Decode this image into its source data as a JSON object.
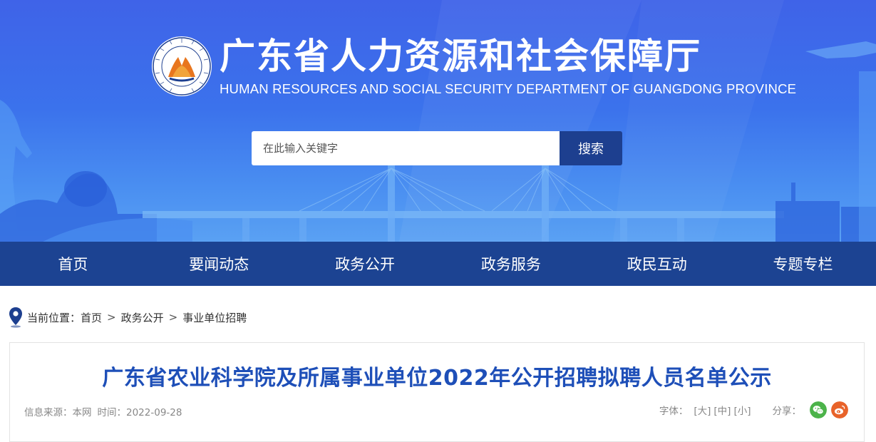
{
  "header": {
    "title_cn": "广东省人力资源和社会保障厅",
    "title_en": "HUMAN RESOURCES AND SOCIAL SECURITY DEPARTMENT OF GUANGDONG PROVINCE"
  },
  "search": {
    "placeholder": "在此输入关键字",
    "button_label": "搜索"
  },
  "nav": {
    "items": [
      {
        "label": "首页"
      },
      {
        "label": "要闻动态"
      },
      {
        "label": "政务公开"
      },
      {
        "label": "政务服务"
      },
      {
        "label": "政民互动"
      },
      {
        "label": "专题专栏"
      }
    ]
  },
  "breadcrumb": {
    "prefix": "当前位置：",
    "items": [
      {
        "label": "首页"
      },
      {
        "label": "政务公开"
      },
      {
        "label": "事业单位招聘"
      }
    ],
    "separator": ">"
  },
  "article": {
    "title": "广东省农业科学院及所属事业单位2022年公开招聘拟聘人员名单公示",
    "source": "信息来源：本网",
    "time": "时间：2022-09-28",
    "font_label": "字体：",
    "font_sizes": [
      "[大]",
      "[中]",
      "[小]"
    ],
    "share_label": "分享："
  },
  "colors": {
    "nav_bg": "#1c4392",
    "search_button": "#1d3f8f",
    "title_blue": "#1e4fb8",
    "wechat": "#4cb34a",
    "weibo": "#e8632a"
  },
  "icons": {
    "emblem": "emblem-icon",
    "location": "location-pin-icon",
    "wechat": "wechat-icon",
    "weibo": "weibo-icon"
  }
}
